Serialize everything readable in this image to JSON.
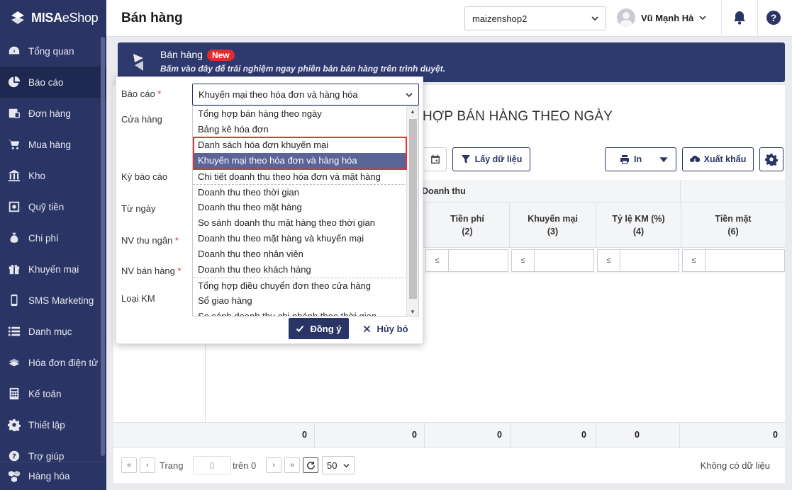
{
  "brand": {
    "name_bold": "MISA",
    "name_thin": "eShop"
  },
  "sidebar": {
    "items": [
      {
        "label": "Tổng quan",
        "icon": "dashboard-icon"
      },
      {
        "label": "Báo cáo",
        "icon": "pie-chart-icon",
        "active": true
      },
      {
        "label": "Đơn hàng",
        "icon": "order-icon"
      },
      {
        "label": "Mua hàng",
        "icon": "cart-icon"
      },
      {
        "label": "Kho",
        "icon": "warehouse-icon"
      },
      {
        "label": "Quỹ tiền",
        "icon": "safe-icon"
      },
      {
        "label": "Chi phí",
        "icon": "money-bag-icon"
      },
      {
        "label": "Khuyến mại",
        "icon": "gift-icon"
      },
      {
        "label": "SMS Marketing",
        "icon": "phone-icon"
      },
      {
        "label": "Danh mục",
        "icon": "list-icon"
      },
      {
        "label": "Hóa đơn điện tử",
        "icon": "invoice-icon"
      },
      {
        "label": "Kế toán",
        "icon": "calculator-icon"
      },
      {
        "label": "Thiết lập",
        "icon": "gear-icon"
      },
      {
        "label": "Trợ giúp",
        "icon": "help-icon"
      }
    ],
    "bottom": {
      "label": "Hàng hóa",
      "icon": "boxes-icon"
    }
  },
  "header": {
    "title": "Bán hàng",
    "shop": "maizenshop2",
    "user": "Vũ Mạnh Hà"
  },
  "banner": {
    "title": "Bán hàng",
    "badge": "New",
    "subtitle": "Bấm vào đây để trải nghiệm ngay phiên bản bán hàng trên trình duyệt."
  },
  "report": {
    "title_visible": "HỢP BÁN HÀNG THEO NGÀY",
    "get_data": "Lấy dữ liệu",
    "print": "In",
    "export": "Xuất khẩu",
    "group_header": "Doanh thu",
    "columns": [
      {
        "name": "Tiền phí",
        "idx": "(2)"
      },
      {
        "name": "Khuyến mại",
        "idx": "(3)"
      },
      {
        "name": "Tỷ lệ KM (%)",
        "idx": "(4)"
      },
      {
        "name": "Tiền mặt",
        "idx": "(6)"
      }
    ],
    "filter_op": "≤",
    "totals": [
      "0",
      "0",
      "0",
      "0",
      "0",
      "0"
    ]
  },
  "pager": {
    "page_label": "Trang",
    "page_value": "0",
    "of_label": "trên 0",
    "page_size": "50",
    "no_data": "Không có dữ liệu"
  },
  "dialog": {
    "labels": {
      "report": "Báo cáo",
      "store": "Cửa hàng",
      "period": "Kỳ báo cáo",
      "from": "Từ ngày",
      "cashier": "NV thu ngân",
      "seller": "NV bán hàng",
      "promo_type": "Loại KM"
    },
    "required_mark": "*",
    "selected": "Khuyến mại theo hóa đơn và hàng hóa",
    "options": [
      "Tổng hợp bán hàng theo ngày",
      "Bảng kê hóa đơn",
      "Danh sách hóa đơn khuyến mại",
      "Khuyến mại theo hóa đơn và hàng hóa",
      "Chi tiết doanh thu theo hóa đơn và mặt hàng",
      "Doanh thu theo thời gian",
      "Doanh thu theo mặt hàng",
      "So sánh doanh thu mặt hàng theo thời gian",
      "Doanh thu theo mặt hàng và khuyến mại",
      "Doanh thu theo nhân viên",
      "Doanh thu theo khách hàng",
      "Tổng hợp điều chuyển đơn theo cửa hàng",
      "Sổ giao hàng",
      "So sánh doanh thu chi nhánh theo thời gian"
    ],
    "ok": "Đồng ý",
    "cancel": "Hủy bỏ"
  }
}
